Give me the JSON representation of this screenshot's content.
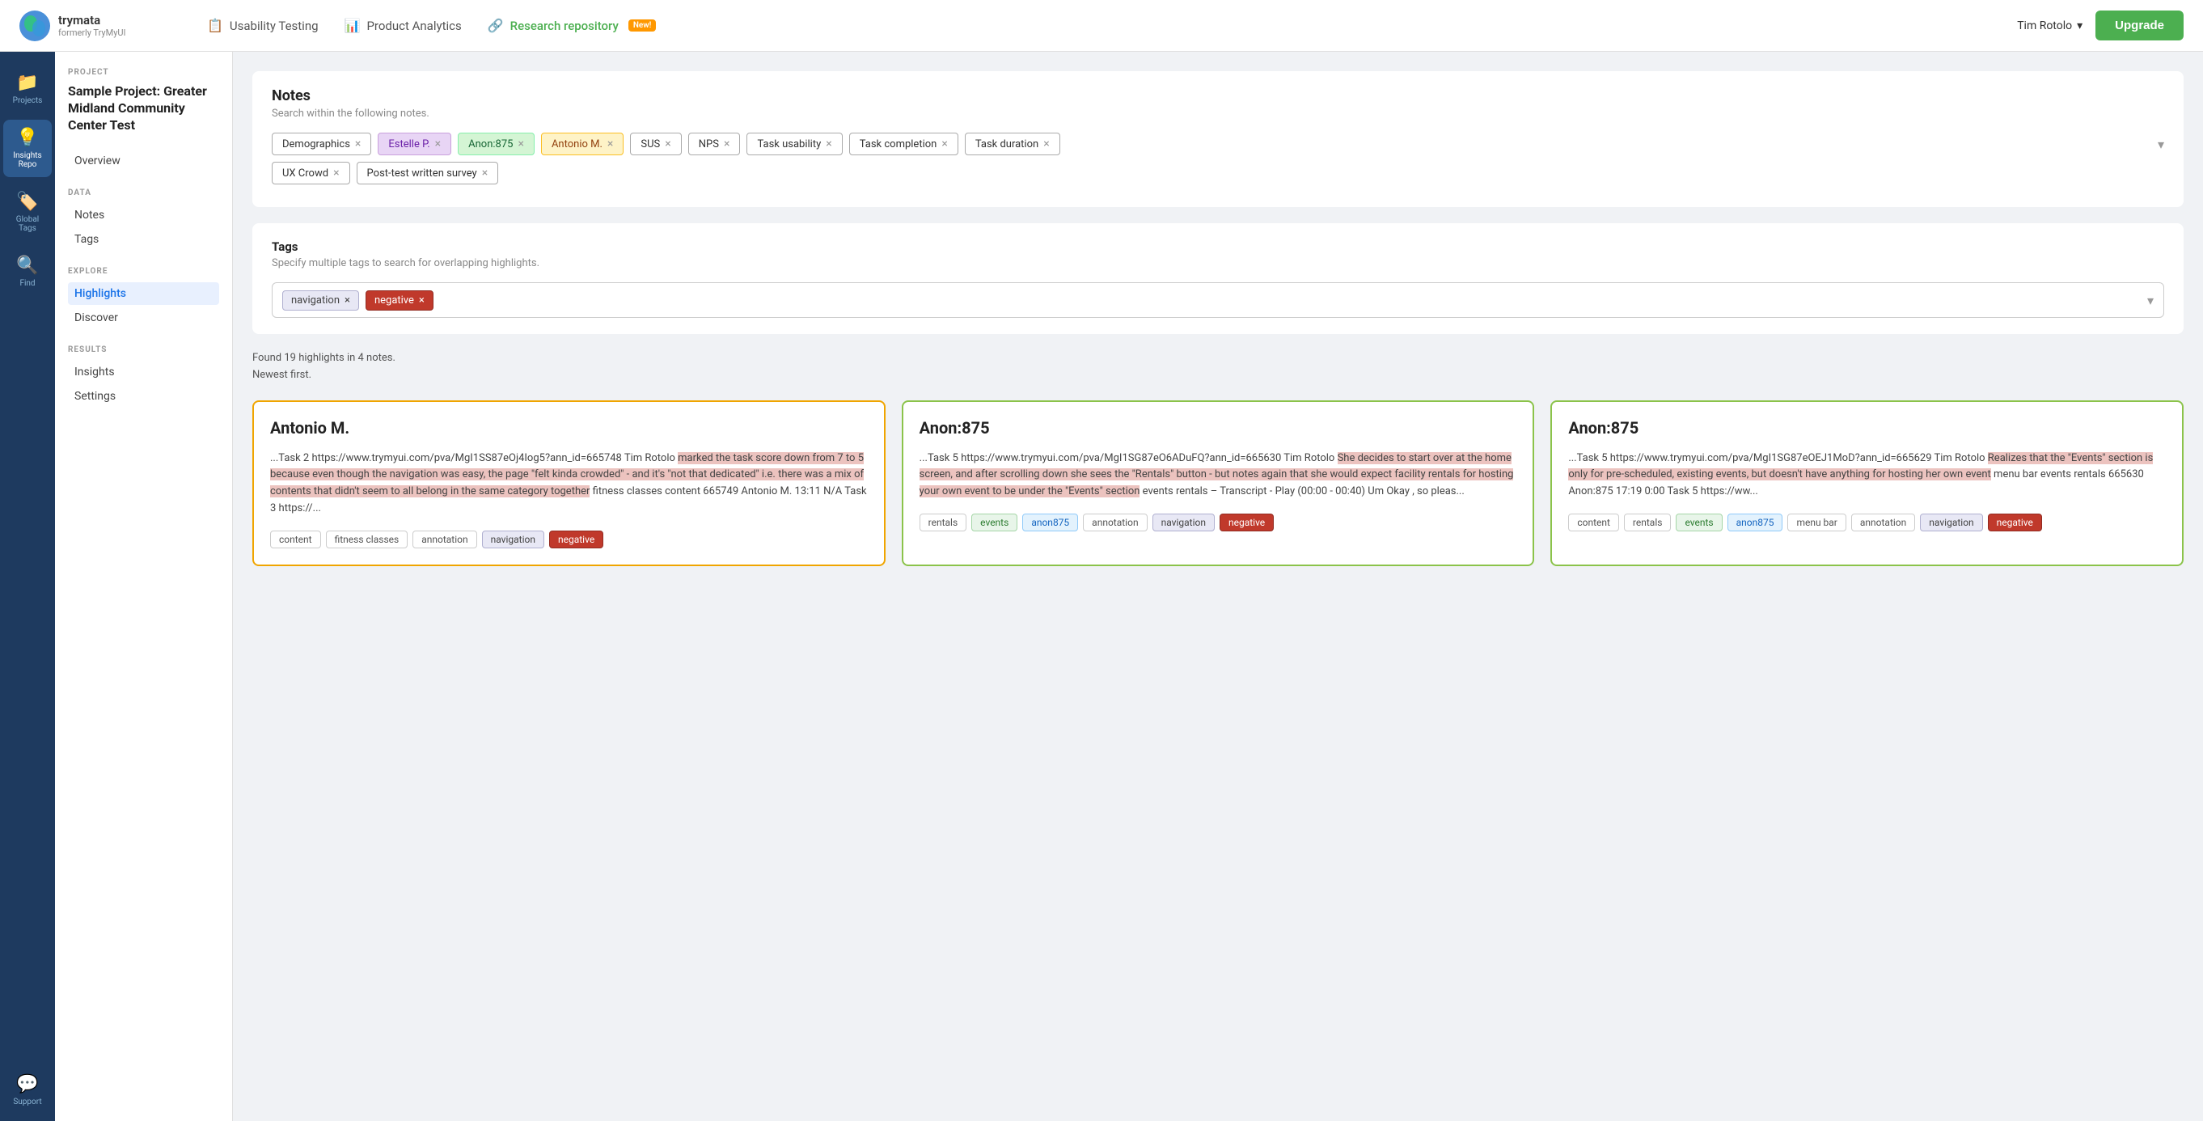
{
  "app": {
    "name": "trymata",
    "formerly": "formerly TryMyUI"
  },
  "topNav": {
    "items": [
      {
        "id": "usability",
        "label": "Usability Testing",
        "icon": "📋",
        "active": false
      },
      {
        "id": "analytics",
        "label": "Product Analytics",
        "icon": "📊",
        "active": false
      },
      {
        "id": "repository",
        "label": "Research repository",
        "icon": "🔗",
        "active": true,
        "badge": "New!"
      }
    ],
    "user": "Tim Rotolo",
    "upgradeLabel": "Upgrade"
  },
  "sidebar": {
    "items": [
      {
        "id": "projects",
        "label": "Projects",
        "icon": "📁",
        "active": false
      },
      {
        "id": "insights",
        "label": "Insights Repo",
        "icon": "💡",
        "active": true
      },
      {
        "id": "global-tags",
        "label": "Global Tags",
        "icon": "🏷️",
        "active": false
      },
      {
        "id": "find",
        "label": "Find",
        "icon": "🔍",
        "active": false
      },
      {
        "id": "support",
        "label": "Support",
        "icon": "💬",
        "active": false
      }
    ]
  },
  "secondarySidebar": {
    "projectLabel": "PROJECT",
    "projectName": "Sample Project: Greater Midland Community Center Test",
    "overviewItem": "Overview",
    "dataLabel": "DATA",
    "dataItems": [
      "Notes",
      "Tags"
    ],
    "exploreLabel": "EXPLORE",
    "exploreItems": [
      "Highlights",
      "Discover"
    ],
    "resultsLabel": "RESULTS",
    "resultsItems": [
      "Insights",
      "Settings"
    ]
  },
  "notesSection": {
    "title": "Notes",
    "subtitle": "Search within the following notes.",
    "filters": [
      {
        "id": "demographics",
        "label": "Demographics",
        "class": "demographics"
      },
      {
        "id": "estelle",
        "label": "Estelle P.",
        "class": "estelle"
      },
      {
        "id": "anon875",
        "label": "Anon:875",
        "class": "anon"
      },
      {
        "id": "antonio",
        "label": "Antonio M.",
        "class": "antonio"
      },
      {
        "id": "sus",
        "label": "SUS",
        "class": "sus"
      },
      {
        "id": "nps",
        "label": "NPS",
        "class": "nps"
      },
      {
        "id": "task-usability",
        "label": "Task usability",
        "class": "task-usability"
      },
      {
        "id": "task-completion",
        "label": "Task completion",
        "class": "task-completion"
      },
      {
        "id": "task-duration",
        "label": "Task duration",
        "class": "task-duration"
      }
    ],
    "filtersRow2": [
      {
        "id": "ux-crowd",
        "label": "UX Crowd",
        "class": "ux-crowd"
      },
      {
        "id": "post-test",
        "label": "Post-test written survey",
        "class": "post-test"
      }
    ]
  },
  "tagsSection": {
    "title": "Tags",
    "subtitle": "Specify multiple tags to search for overlapping highlights.",
    "tags": [
      {
        "id": "navigation",
        "label": "navigation",
        "class": "navigation"
      },
      {
        "id": "negative",
        "label": "negative",
        "class": "negative"
      }
    ]
  },
  "results": {
    "count": "Found 19 highlights in 4 notes.",
    "order": "Newest first."
  },
  "cards": [
    {
      "id": "card1",
      "title": "Antonio M.",
      "borderClass": "antonio-card",
      "textBefore": "...Task 2 https://www.trymyui.com/pva/MgI1SS87eOj4Iog5?ann_id=665748 Tim Rotolo ",
      "highlight": "marked the task score down from 7 to 5 because even though the navigation was easy, the page \"felt kinda crowded\" - and it's \"not that dedicated\" i.e. there was a mix of contents that didn't seem to all belong in the same category together",
      "textAfter": "fitness classes content 665749 Antonio M. 13:11 N/A Task 3 https://...",
      "tags": [
        {
          "label": "content",
          "class": "ct-content"
        },
        {
          "label": "fitness classes",
          "class": "ct-fitness"
        },
        {
          "label": "annotation",
          "class": "ct-annotation"
        },
        {
          "label": "navigation",
          "class": "ct-navigation"
        },
        {
          "label": "negative",
          "class": "ct-negative"
        }
      ]
    },
    {
      "id": "card2",
      "title": "Anon:875",
      "borderClass": "anon-card",
      "textBefore": "...Task 5 https://www.trymyui.com/pva/MgI1SG87eO6ADuFQ?ann_id=665630 Tim Rotolo ",
      "highlight": "She decides to start over at the home screen, and after scrolling down she sees the \"Rentals\" button - but notes again that she would expect facility rentals for hosting your own event to be under the \"Events\" section",
      "textAfter": "events rentals – Transcript - Play (00:00 - 00:40) Um Okay , so pleas...",
      "tags": [
        {
          "label": "rentals",
          "class": "ct-rentals"
        },
        {
          "label": "events",
          "class": "ct-events"
        },
        {
          "label": "anon875",
          "class": "ct-anon875"
        },
        {
          "label": "annotation",
          "class": "ct-annotation"
        },
        {
          "label": "navigation",
          "class": "ct-navigation"
        },
        {
          "label": "negative",
          "class": "ct-negative"
        }
      ]
    },
    {
      "id": "card3",
      "title": "Anon:875",
      "borderClass": "anon2-card",
      "textBefore": "...Task 5 https://www.trymyui.com/pva/MgI1SG87eOEJ1MoD?ann_id=665629 Tim Rotolo ",
      "highlight": "Realizes that the \"Events\" section is only for pre-scheduled, existing events, but doesn't have anything for hosting her own event",
      "textAfter": "menu bar events rentals 665630 Anon:875 17:19 0:00 Task 5 https://ww...",
      "tags": [
        {
          "label": "content",
          "class": "ct-content"
        },
        {
          "label": "rentals",
          "class": "ct-rentals"
        },
        {
          "label": "events",
          "class": "ct-events"
        },
        {
          "label": "anon875",
          "class": "ct-anon875"
        },
        {
          "label": "menu bar",
          "class": "ct-menu-bar"
        },
        {
          "label": "annotation",
          "class": "ct-annotation"
        },
        {
          "label": "navigation",
          "class": "ct-navigation"
        },
        {
          "label": "negative",
          "class": "ct-negative"
        }
      ]
    }
  ]
}
